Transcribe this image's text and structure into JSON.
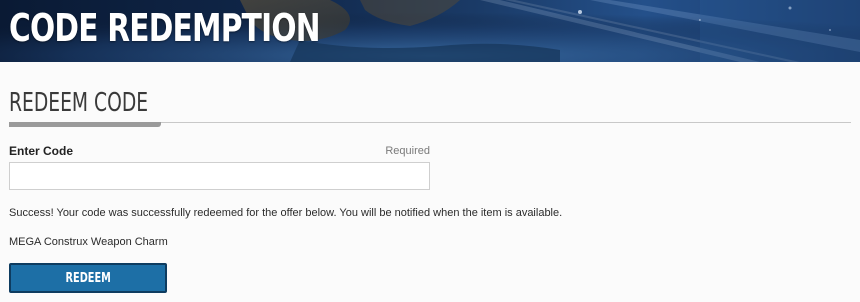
{
  "header": {
    "title": "CODE REDEMPTION"
  },
  "section": {
    "title": "REDEEM CODE"
  },
  "form": {
    "field_label": "Enter Code",
    "required_label": "Required",
    "code_value": "",
    "code_placeholder": ""
  },
  "status": {
    "success_message": "Success! Your code was successfully redeemed for the offer below. You will be notified when the item is available.",
    "offer_name": "MEGA Construx Weapon Charm"
  },
  "actions": {
    "redeem_label": "REDEEM"
  },
  "colors": {
    "button_blue": "#1d6fa6",
    "button_border": "#0e3c60",
    "hero_dark": "#0a1a34"
  }
}
